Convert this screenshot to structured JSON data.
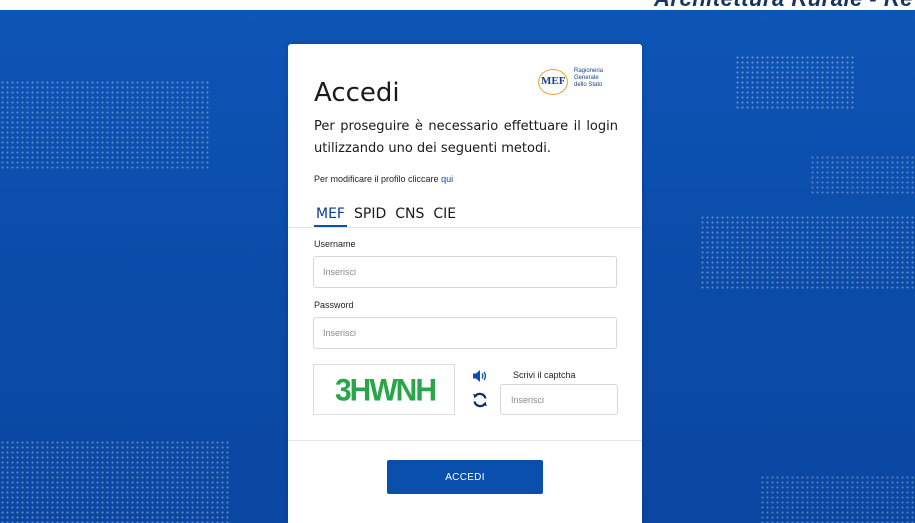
{
  "header": {
    "cut_title": "Architettura Rurale - Re"
  },
  "logo": {
    "emblem_text": "MEF",
    "line1": "Ragioneria",
    "line2": "Generale",
    "line3": "dello Stato"
  },
  "login": {
    "title": "Accedi",
    "description": "Per proseguire è necessario effettuare il login utilizzando uno dei seguenti metodi.",
    "profile_text": "Per modificare il profilo cliccare",
    "profile_link": "qui",
    "tabs": [
      {
        "label": "MEF",
        "active": true
      },
      {
        "label": "SPID",
        "active": false
      },
      {
        "label": "CNS",
        "active": false
      },
      {
        "label": "CIE",
        "active": false
      }
    ],
    "username": {
      "label": "Username",
      "value": "",
      "placeholder": "Inserisci"
    },
    "password": {
      "label": "Password",
      "value": "",
      "placeholder": "Inserisci"
    },
    "captcha": {
      "image_text": "3HWNH",
      "label": "Scrivi il captcha",
      "value": "",
      "placeholder": "Inserisci",
      "audio_icon": "speaker-icon",
      "refresh_icon": "refresh-icon"
    },
    "submit_label": "ACCEDI"
  },
  "colors": {
    "background": "#0b4fae",
    "accent": "#0b4fae",
    "captcha_text": "#2aa64a",
    "card": "#ffffff"
  }
}
